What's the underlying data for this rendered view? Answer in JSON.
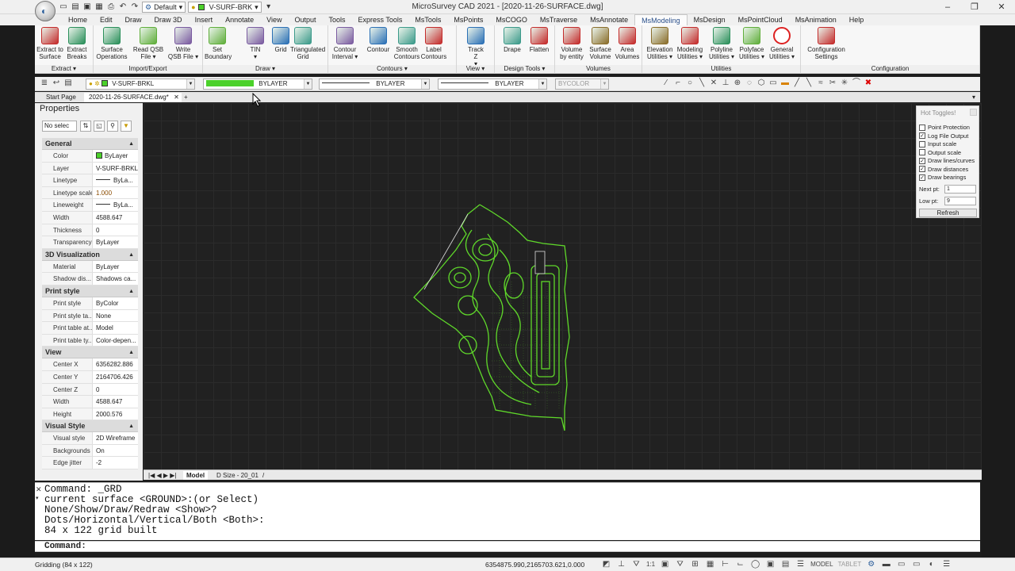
{
  "window": {
    "title": "MicroSurvey CAD 2021 - [2020-11-26-SURFACE.dwg]",
    "buttons": [
      "–",
      "❐",
      "✕"
    ]
  },
  "qat": {
    "workspace": "Default",
    "layer": "V-SURF-BRK"
  },
  "menu_tabs": [
    "Home",
    "Edit",
    "Draw",
    "Draw 3D",
    "Insert",
    "Annotate",
    "View",
    "Output",
    "Tools",
    "Express Tools",
    "MsTools",
    "MsPoints",
    "MsCOGO",
    "MsTraverse",
    "MsAnnotate",
    "MsModeling",
    "MsDesign",
    "MsPointCloud",
    "MsAnimation",
    "Help"
  ],
  "active_tab": "MsModeling",
  "ribbon": {
    "groups": [
      {
        "title": "Extract ▾",
        "buttons": [
          "Extract to\nSurface",
          "Extract\nBreaks"
        ]
      },
      {
        "title": "Import/Export",
        "buttons": [
          "Surface\nOperations",
          "Read QSB\nFile ▾",
          "Write\nQSB File ▾"
        ]
      },
      {
        "title": "Draw ▾",
        "buttons": [
          "Set\nBoundary",
          "TIN\n▾",
          "Grid",
          "Triangulated\nGrid"
        ]
      },
      {
        "title": "Contours ▾",
        "buttons": [
          "Contour\nInterval ▾",
          "Contour",
          "Smooth\nContours",
          "Label\nContours"
        ]
      },
      {
        "title": "View ▾",
        "buttons": [
          "Track\nZ\n▾"
        ]
      },
      {
        "title": "Design Tools ▾",
        "buttons": [
          "Drape",
          "Flatten"
        ]
      },
      {
        "title": "Volumes",
        "buttons": [
          "Volume\nby entity",
          "Surface\nVolume",
          "Area\nVolumes"
        ]
      },
      {
        "title": "Utilities",
        "buttons": [
          "Elevation\nUtilities ▾",
          "Modeling\nUtilities ▾",
          "Polyline\nUtilities ▾",
          "Polyface\nUtilities ▾",
          "General\nUtilities ▾"
        ]
      },
      {
        "title": "Configuration",
        "buttons": [
          "Configuration\nSettings"
        ]
      }
    ]
  },
  "props_toolbar": {
    "layer": "V-SURF-BRKL",
    "color": "BYLAYER",
    "linetype": "BYLAYER",
    "lineweight": "BYLAYER",
    "plotstyle": "BYCOLOR"
  },
  "doc_tabs": {
    "start": "Start Page",
    "active": "2020-11-26-SURFACE.dwg*",
    "close": "✕",
    "add": "+"
  },
  "properties": {
    "title": "Properties",
    "selection": "No selec",
    "sections": [
      {
        "name": "General",
        "rows": [
          [
            "Color",
            "ByLayer"
          ],
          [
            "Layer",
            "V-SURF-BRKL"
          ],
          [
            "Linetype",
            "ByLa..."
          ],
          [
            "Linetype scale",
            "1.000"
          ],
          [
            "Lineweight",
            "ByLa..."
          ],
          [
            "Width",
            "4588.647"
          ],
          [
            "Thickness",
            "0"
          ],
          [
            "Transparency",
            "ByLayer"
          ]
        ]
      },
      {
        "name": "3D Visualization",
        "rows": [
          [
            "Material",
            "ByLayer"
          ],
          [
            "Shadow dis...",
            "Shadows ca..."
          ]
        ]
      },
      {
        "name": "Print style",
        "rows": [
          [
            "Print style",
            "ByColor"
          ],
          [
            "Print style ta...",
            "None"
          ],
          [
            "Print table at...",
            "Model"
          ],
          [
            "Print table ty...",
            "Color-depen..."
          ]
        ]
      },
      {
        "name": "View",
        "rows": [
          [
            "Center X",
            "6356282.886"
          ],
          [
            "Center Y",
            "2164706.426"
          ],
          [
            "Center Z",
            "0"
          ],
          [
            "Width",
            "4588.647"
          ],
          [
            "Height",
            "2000.576"
          ]
        ]
      },
      {
        "name": "Visual Style",
        "rows": [
          [
            "Visual style",
            "2D Wireframe"
          ],
          [
            "Backgrounds",
            "On"
          ],
          [
            "Edge jitter",
            "-2"
          ]
        ]
      }
    ]
  },
  "hot_toggles": {
    "title": "Hot Toggles!",
    "items": [
      {
        "label": "Point Protection",
        "checked": false
      },
      {
        "label": "Log File Output",
        "checked": true
      },
      {
        "label": "Input scale",
        "checked": false
      },
      {
        "label": "Output scale",
        "checked": false
      },
      {
        "label": "Draw lines/curves",
        "checked": true
      },
      {
        "label": "Draw distances",
        "checked": true
      },
      {
        "label": "Draw bearings",
        "checked": true
      }
    ],
    "next_pt_label": "Next pt:",
    "next_pt": "1",
    "low_pt_label": "Low pt:",
    "low_pt": "9",
    "refresh": "Refresh"
  },
  "layout_tabs": {
    "nav": "|◀ ◀ ▶ ▶|",
    "model": "Model",
    "layout": "D Size - 20_01",
    "sep": "/"
  },
  "command": {
    "lines": [
      "Command: _GRD",
      "current surface <GROUND>:(or Select)",
      "None/Show/Draw/Redraw <Show>?",
      "Dots/Horizontal/Vertical/Both <Both>:",
      "84 x 122 grid built"
    ],
    "prompt": "Command:"
  },
  "status": {
    "message": "Gridding (84 x 122)",
    "coords": "6354875.990,2165703.621,0.000",
    "scale": "1:1",
    "model": "MODEL",
    "tablet": "TABLET"
  },
  "colors": {
    "drawing": "#5fd82a",
    "canvas": "#212121",
    "accent": "#2a4f8a"
  }
}
